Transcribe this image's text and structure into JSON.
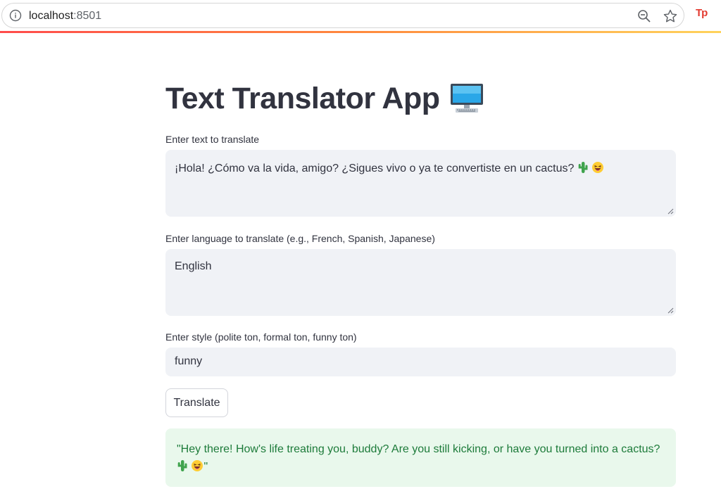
{
  "browser": {
    "url_host": "localhost",
    "url_port": ":8501",
    "icons": [
      "info-icon",
      "zoom-out-icon",
      "star-icon",
      "extension-tp-icon"
    ],
    "extension_label": "Tp"
  },
  "app": {
    "title": "Text Translator App",
    "title_icon": "desktop-computer-icon",
    "accent_colors": {
      "stripe_start": "#ff4b4b",
      "stripe_end": "#ffd35c",
      "success_bg": "#e9f8ec",
      "success_text": "#1d7b3a",
      "input_bg": "#f0f2f6"
    }
  },
  "form": {
    "text_label": "Enter text to translate",
    "text_value": "¡Hola! ¿Cómo va la vida, amigo? ¿Sigues vivo o ya te convertiste en un cactus?",
    "language_label": "Enter language to translate (e.g., French, Spanish, Japanese)",
    "language_value": "English",
    "style_label": "Enter style (polite ton, formal ton, funny ton)",
    "style_value": "funny",
    "translate_button": "Translate"
  },
  "result": {
    "text_part1": "\"Hey there! How's life treating you, buddy? Are you still kicking, or have you turned into a cactus?",
    "text_part2": "\""
  }
}
